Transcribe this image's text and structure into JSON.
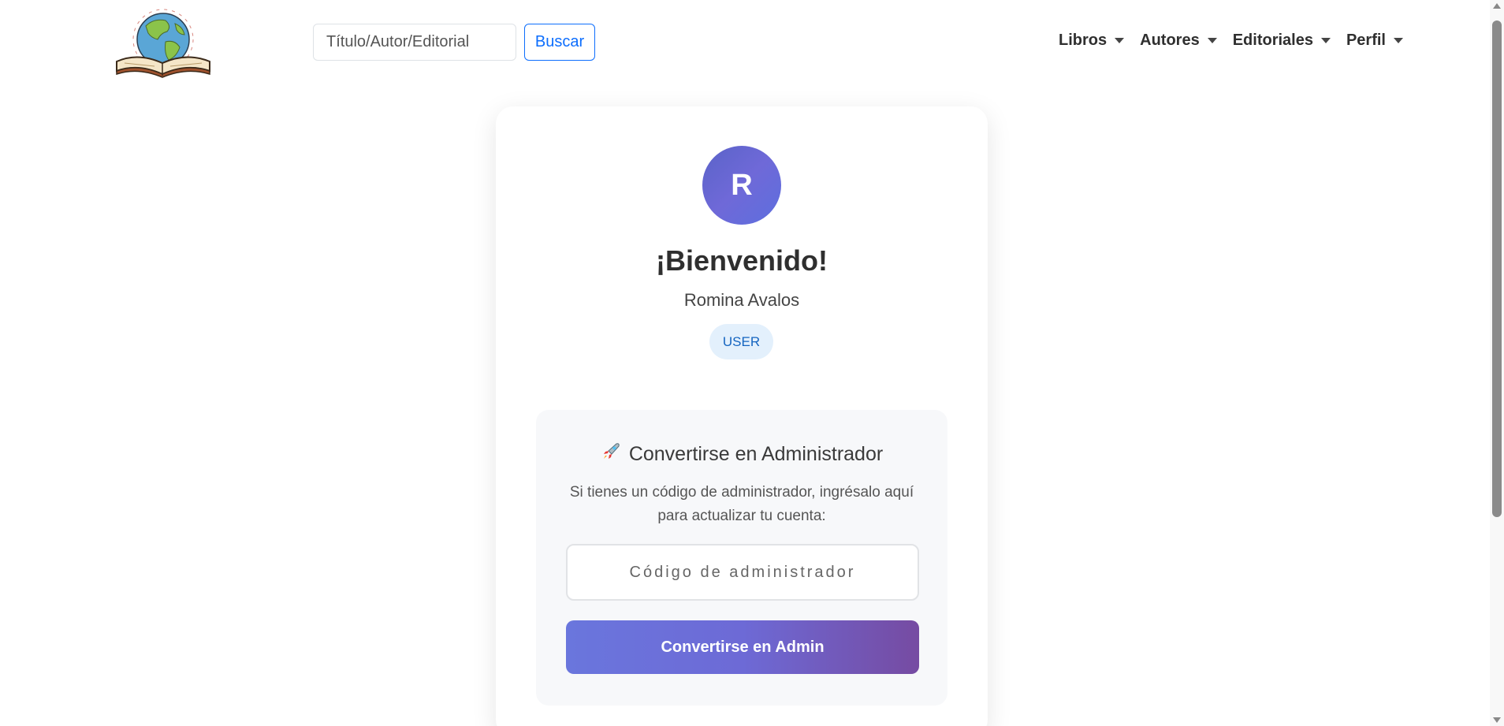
{
  "navbar": {
    "search": {
      "placeholder": "Título/Autor/Editorial",
      "button_label": "Buscar"
    },
    "menu": [
      {
        "label": "Libros"
      },
      {
        "label": "Autores"
      },
      {
        "label": "Editoriales"
      },
      {
        "label": "Perfil"
      }
    ]
  },
  "profile": {
    "avatar_initial": "R",
    "welcome": "¡Bienvenido!",
    "name": "Romina Avalos",
    "role": "USER"
  },
  "admin_upgrade": {
    "icon": "rocket-icon",
    "title": "Convertirse en Administrador",
    "description": "Si tienes un código de administrador, ingrésalo aquí para actualizar tu cuenta:",
    "code_placeholder": "Código de administrador",
    "button_label": "Convertirse en Admin"
  },
  "colors": {
    "primary": "#0d6efd",
    "gradient_start": "#667eea",
    "gradient_end": "#764ba2",
    "badge_bg": "#e3f0fc",
    "badge_text": "#1565c0"
  }
}
